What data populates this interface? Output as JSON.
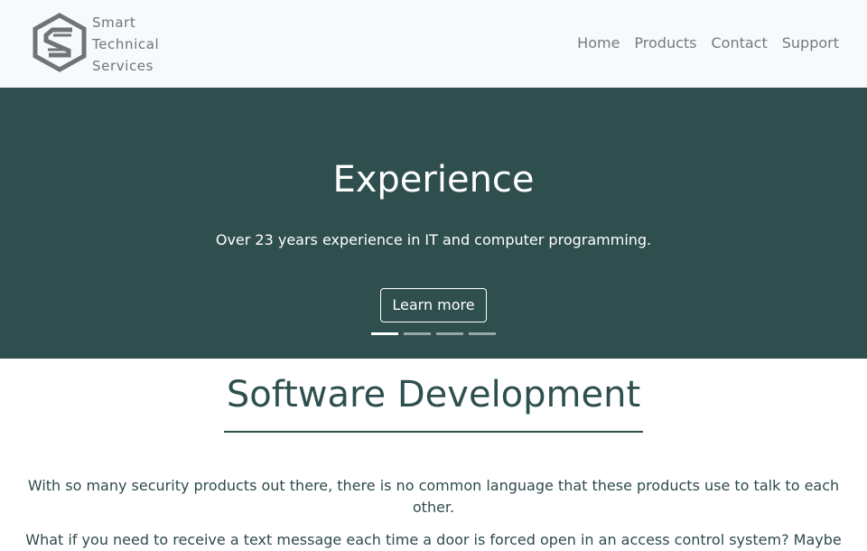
{
  "header": {
    "logo": {
      "icon": "s-hexagon-logo-icon",
      "lines": [
        "Smart",
        "Technical",
        "Services"
      ]
    },
    "nav": [
      {
        "label": "Home"
      },
      {
        "label": "Products"
      },
      {
        "label": "Contact"
      },
      {
        "label": "Support"
      }
    ]
  },
  "hero": {
    "title": "Experience",
    "text": "Over 23 years experience in IT and computer programming.",
    "button_label": "Learn more",
    "slides_total": 4,
    "active_slide": 1,
    "background": "#2f4f4f"
  },
  "main": {
    "title": "Software Development",
    "paragraphs": [
      "With so many security products out there, there is no common language that these products use to talk to each other.",
      "What if you need to receive a text message each time a door is forced open in an access control system? Maybe"
    ]
  },
  "colors": {
    "accent": "#2f4f4f",
    "nav_text": "#737b81",
    "navbar_bg": "#f8f9fa"
  }
}
